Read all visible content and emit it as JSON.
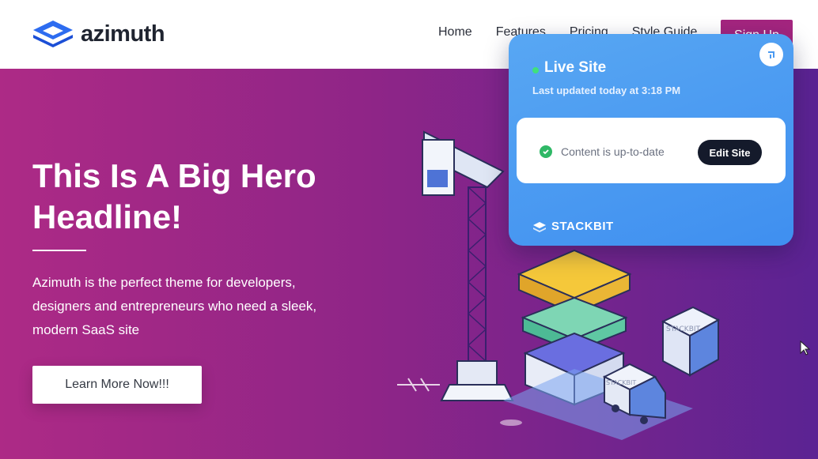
{
  "header": {
    "logo_text": "azimuth",
    "nav": [
      "Home",
      "Features",
      "Pricing",
      "Style Guide"
    ],
    "signup_label": "Sign Up"
  },
  "hero": {
    "headline": "This Is A Big Hero Headline!",
    "description": "Azimuth is the perfect theme for developers, designers and entrepreneurs who need a sleek, modern SaaS site",
    "cta_label": "Learn More Now!!!",
    "illustration_text": [
      "STACKBIT",
      "STACKBIT"
    ]
  },
  "widget": {
    "title": "Live Site",
    "subtitle": "Last updated today at 3:18 PM",
    "status": "Content is up-to-date",
    "edit_label": "Edit Site",
    "brand": "STACKBIT"
  },
  "colors": {
    "brand_purple": "#a4257f",
    "hero_start": "#ad2a86",
    "hero_end": "#5b2393",
    "widget_blue": "#4a9af2",
    "status_green": "#2fb866"
  },
  "icons": [
    "azimuth-logo-icon",
    "collapse-icon",
    "check-circle-icon",
    "stackbit-logo-icon",
    "cursor-icon"
  ]
}
